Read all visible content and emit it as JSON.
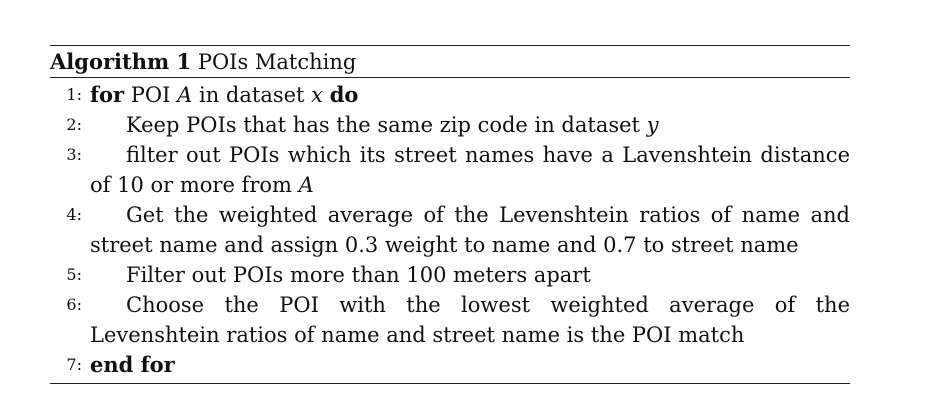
{
  "algorithm": {
    "caption_label": "Algorithm 1",
    "caption_title": "POIs Matching",
    "lines": [
      {
        "num": "1:",
        "kw_start": "for",
        "pre": "POI",
        "var1": "A",
        "mid": "in dataset",
        "var2": "x",
        "kw_end": "do"
      },
      {
        "num": "2:",
        "text": "Keep POIs that has the same zip code in dataset",
        "var": "y"
      },
      {
        "num": "3:",
        "text": "filter out POIs which its street names have a Lavenshtein distance of 10 or more from",
        "var": "A"
      },
      {
        "num": "4:",
        "text": "Get the weighted average of the Levenshtein ratios of name and street name and assign 0.3 weight to name and 0.7 to street name"
      },
      {
        "num": "5:",
        "text": "Filter out POIs more than 100 meters apart"
      },
      {
        "num": "6:",
        "text": "Choose the POI with the lowest weighted average of the Levenshtein ratios of name and street name is the POI match"
      },
      {
        "num": "7:",
        "kw": "end for"
      }
    ]
  }
}
